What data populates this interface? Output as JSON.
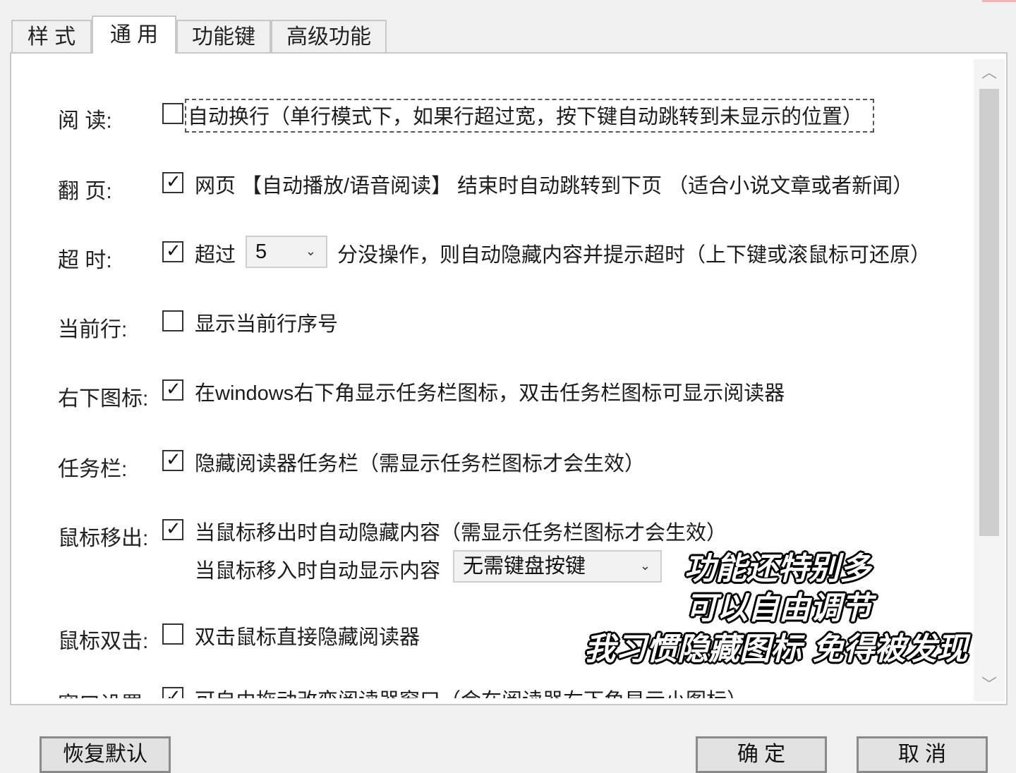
{
  "tabs": [
    {
      "label": "样 式",
      "active": false
    },
    {
      "label": "通 用",
      "active": true
    },
    {
      "label": "功能键",
      "active": false
    },
    {
      "label": "高级功能",
      "active": false
    }
  ],
  "settings": {
    "reading": {
      "label": "阅 读:",
      "checked": false,
      "text": "自动换行（单行模式下，如果行超过宽，按下键自动跳转到未显示的位置）"
    },
    "page_turn": {
      "label": "翻 页:",
      "checked": true,
      "text": "网页 【自动播放/语音阅读】 结束时自动跳转到下页 （适合小说文章或者新闻）"
    },
    "timeout": {
      "label": "超 时:",
      "checked": true,
      "prefix": "超过",
      "select_value": "5",
      "suffix": "分没操作，则自动隐藏内容并提示超时（上下键或滚鼠标可还原）"
    },
    "current_line": {
      "label": "当前行:",
      "checked": false,
      "text": "显示当前行序号"
    },
    "tray_icon": {
      "label": "右下图标:",
      "checked": true,
      "text": "在windows右下角显示任务栏图标，双击任务栏图标可显示阅读器"
    },
    "taskbar": {
      "label": "任务栏:",
      "checked": true,
      "text": "隐藏阅读器任务栏（需显示任务栏图标才会生效）"
    },
    "mouse_out": {
      "label": "鼠标移出:",
      "checked": true,
      "text": "当鼠标移出时自动隐藏内容（需显示任务栏图标才会生效）",
      "sub_text": "当鼠标移入时自动显示内容",
      "select_value": "无需键盘按键"
    },
    "double_click": {
      "label": "鼠标双击:",
      "checked": false,
      "text": "双击鼠标直接隐藏阅读器"
    },
    "window_setting": {
      "label": "窗口设置:",
      "checked": true,
      "text": "可自由拖动改变阅读器窗口（会在阅读器右下角显示小图标）"
    }
  },
  "caption": {
    "line1": "功能还特别多",
    "line2": "可以自由调节",
    "line3": "我习惯隐藏图标 免得被发现"
  },
  "buttons": {
    "restore": "恢复默认",
    "ok": "确 定",
    "cancel": "取 消"
  },
  "icons": {
    "check": "✓",
    "scroll_up": "chevron-up-icon",
    "scroll_down": "chevron-down-icon"
  }
}
